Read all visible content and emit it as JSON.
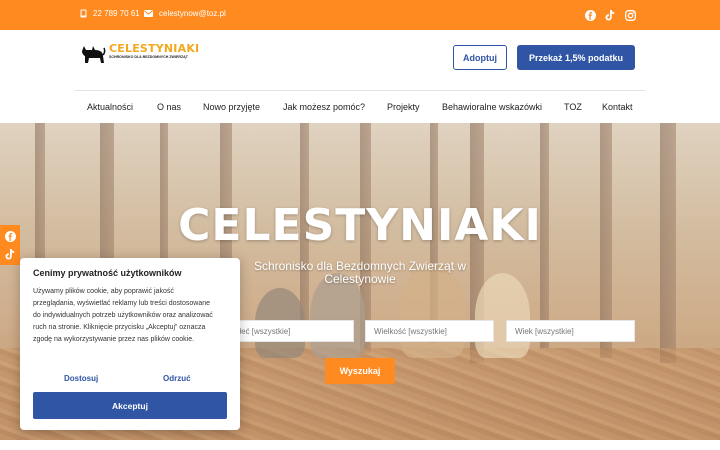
{
  "topbar": {
    "phone": "22 789 70 61",
    "email": "celestynow@toz.pl",
    "social_icons": [
      "facebook-icon",
      "tiktok-icon",
      "instagram-icon"
    ],
    "color": "#ff8a1f"
  },
  "header": {
    "logo_title": "CELESTYNIAKI",
    "logo_subtitle": "SCHRONISKO DLA BEZDOMNYCH ZWIERZĄT",
    "adopt_label": "Adoptuj",
    "tax_label": "Przekaż 1,5% podatku",
    "brand_blue": "#2f55a4"
  },
  "nav": {
    "items": [
      {
        "label": "Aktualności"
      },
      {
        "label": "O nas"
      },
      {
        "label": "Nowo przyjęte"
      },
      {
        "label": "Jak możesz pomóc?"
      },
      {
        "label": "Projekty"
      },
      {
        "label": "Behawioralne wskazówki"
      },
      {
        "label": "TOZ"
      },
      {
        "label": "Kontakt"
      }
    ]
  },
  "hero": {
    "title": "CELESTYNIAKI",
    "subtitle": "Schronisko dla Bezdomnych Zwierząt w Celestynowie",
    "filters": [
      {
        "placeholder": "Płeć [wszystkie]"
      },
      {
        "placeholder": "Wielkość [wszystkie]"
      },
      {
        "placeholder": "Wiek [wszystkie]"
      }
    ],
    "search_label": "Wyszukaj"
  },
  "cookie": {
    "title": "Cenimy prywatność użytkowników",
    "text": "Używamy plików cookie, aby poprawić jakość przeglądania, wyświetlać reklamy lub treści dostosowane do indywidualnych potrzeb użytkowników oraz analizować ruch na stronie. Kliknięcie przycisku „Akceptuj” oznacza zgodę na wykorzystywanie przez nas plików cookie.",
    "customize_label": "Dostosuj",
    "reject_label": "Odrzuć",
    "accept_label": "Akceptuj"
  }
}
